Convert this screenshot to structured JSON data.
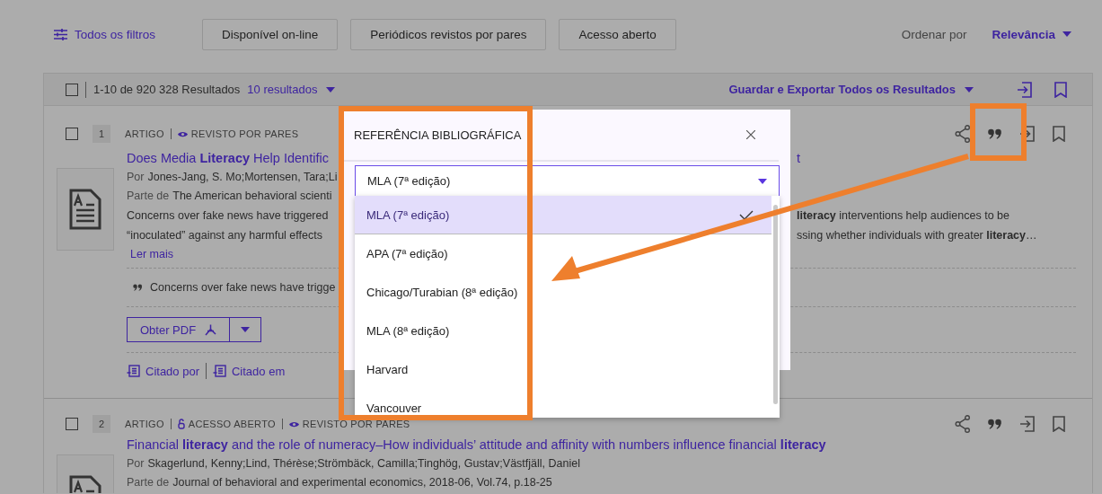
{
  "filters": {
    "all_filters": "Todos os filtros",
    "chips": [
      "Disponível on-line",
      "Periódicos revistos por pares",
      "Acesso aberto"
    ],
    "sort_label": "Ordenar por",
    "sort_value": "Relevância"
  },
  "results_bar": {
    "checked": false,
    "count": "1-10 de 920 328 Resultados",
    "per_page": "10 resultados",
    "export": "Guardar e Exportar Todos os Resultados"
  },
  "results": [
    {
      "checked": false,
      "number": "1",
      "tags": [
        {
          "kind": "type",
          "label": "ARTIGO"
        },
        {
          "kind": "peer",
          "label": "REVISTO POR PARES"
        }
      ],
      "title_left": "Does Media **Literacy** Help Identific",
      "title_right": "t",
      "by_label": "Por",
      "authors": "Jones-Jang, S. Mo;Mortensen, Tara;Li",
      "part_label": "Parte de",
      "source": "The American behavioral scienti",
      "abstract": [
        {
          "left": "Concerns over fake news have triggered",
          "right": "**literacy** interventions help audiences to be"
        },
        {
          "left": "“inoculated” against any harmful effects",
          "right": "ssing whether individuals with greater **literacy**…"
        }
      ],
      "read_more": "Ler mais",
      "snippet": "Concerns over fake news have trigge",
      "pdf_button": "Obter PDF",
      "cited_by": "Citado por",
      "cites": "Citado em"
    },
    {
      "checked": false,
      "number": "2",
      "tags": [
        {
          "kind": "type",
          "label": "ARTIGO"
        },
        {
          "kind": "open",
          "label": "ACESSO ABERTO"
        },
        {
          "kind": "peer",
          "label": "REVISTO POR PARES"
        }
      ],
      "title_left": "Financial **literacy** and the role of numeracy–How individuals’ attitude and affinity with numbers influence financial **literacy**",
      "by_label": "Por",
      "authors": "Skagerlund, Kenny;Lind, Thérèse;Strömbäck, Camilla;Tinghög, Gustav;Västfjäll, Daniel",
      "part_label": "Parte de",
      "source": "Journal of behavioral and experimental economics, 2018-06, Vol.74, p.18-25"
    }
  ],
  "citation_dialog": {
    "title": "REFERÊNCIA BIBLIOGRÁFICA",
    "select_value": "MLA (7ª edição)",
    "options": [
      {
        "label": "MLA (7ª edição)",
        "selected": true
      },
      {
        "label": "APA (7ª edição)",
        "selected": false
      },
      {
        "label": "Chicago/Turabian (8ª edição)",
        "selected": false
      },
      {
        "label": "MLA (8ª edição)",
        "selected": false
      },
      {
        "label": "Harvard",
        "selected": false
      },
      {
        "label": "Vancouver",
        "selected": false
      }
    ]
  }
}
